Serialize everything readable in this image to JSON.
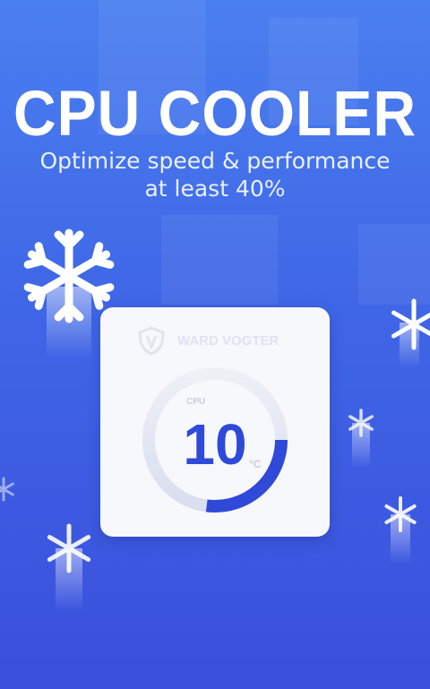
{
  "header": {
    "title": "CPU COOLER",
    "subtitle_line1": "Optimize speed & performance",
    "subtitle_line2": "at least 40%"
  },
  "card": {
    "brand": "WARD VOGTER",
    "gauge_label": "CPU",
    "temperature": "10",
    "unit": "°C",
    "gauge_fill_fraction": 0.27
  },
  "colors": {
    "background_top": "#4a7ff0",
    "background_bottom": "#3a4fdc",
    "accent": "#2f49d8",
    "card": "#f7f8fc"
  },
  "icons": [
    "snowflake-icon",
    "shield-logo-icon"
  ]
}
